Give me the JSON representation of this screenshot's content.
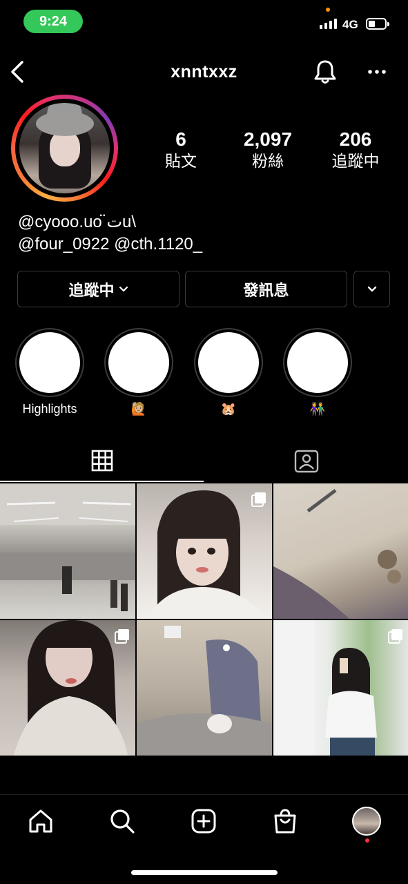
{
  "status_bar": {
    "time": "9:24",
    "network": "4G"
  },
  "nav": {
    "username": "xnntxxz"
  },
  "profile": {
    "stats": [
      {
        "value": "6",
        "label": "貼文"
      },
      {
        "value": "2,097",
        "label": "粉絲"
      },
      {
        "value": "206",
        "label": "追蹤中"
      }
    ],
    "bio": {
      "line1": "@cyooo.uo ت̈u\\",
      "line2": "@four_0922 @cth.1120_"
    }
  },
  "actions": {
    "following_label": "追蹤中",
    "message_label": "發訊息"
  },
  "highlights": [
    {
      "label": "Highlights"
    },
    {
      "label": "🙋🏼"
    },
    {
      "label": "🐹"
    },
    {
      "label": "👫"
    }
  ],
  "tabs": [
    {
      "icon": "grid-icon",
      "active": true
    },
    {
      "icon": "tagged-icon",
      "active": false
    }
  ],
  "posts": [
    {
      "multi": false
    },
    {
      "multi": true
    },
    {
      "multi": false
    },
    {
      "multi": true
    },
    {
      "multi": false
    },
    {
      "multi": true
    }
  ],
  "bottom_nav": [
    "home-icon",
    "search-icon",
    "create-icon",
    "shop-icon",
    "profile-avatar"
  ],
  "colors": {
    "background": "#000000",
    "time_pill": "#34c759",
    "button_border": "#3a3a3a",
    "notification_dot": "#ff3040"
  }
}
